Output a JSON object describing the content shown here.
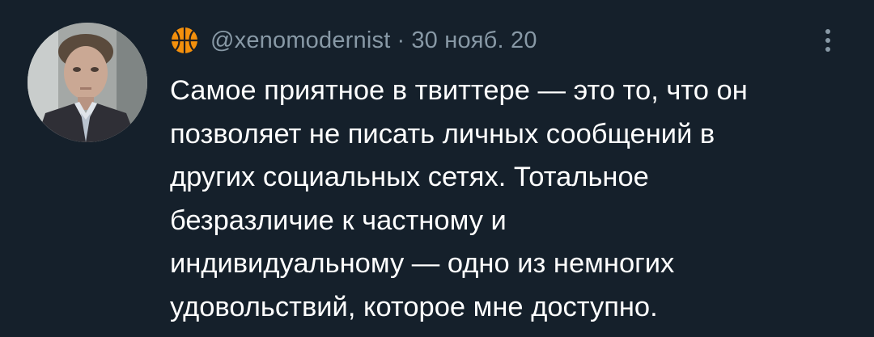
{
  "tweet": {
    "avatar_icon": "profile-photo",
    "badge_icon": "basketball-emoji",
    "handle": "@xenomodernist",
    "separator": "·",
    "date": "30 нояб. 20",
    "more_icon": "vertical-ellipsis-icon",
    "text_lines": [
      "Самое приятное в твиттере — это то, что он",
      "позволяет не писать личных сообщений в",
      "других социальных сетях. Тотальное",
      "безразличие к частному и",
      "индивидуальному — одно из немногих",
      "удовольствий, которое мне доступно."
    ]
  },
  "colors": {
    "background": "#15202b",
    "text": "#ffffff",
    "secondary_text": "#8899a6",
    "basketball": "#f4900c"
  }
}
